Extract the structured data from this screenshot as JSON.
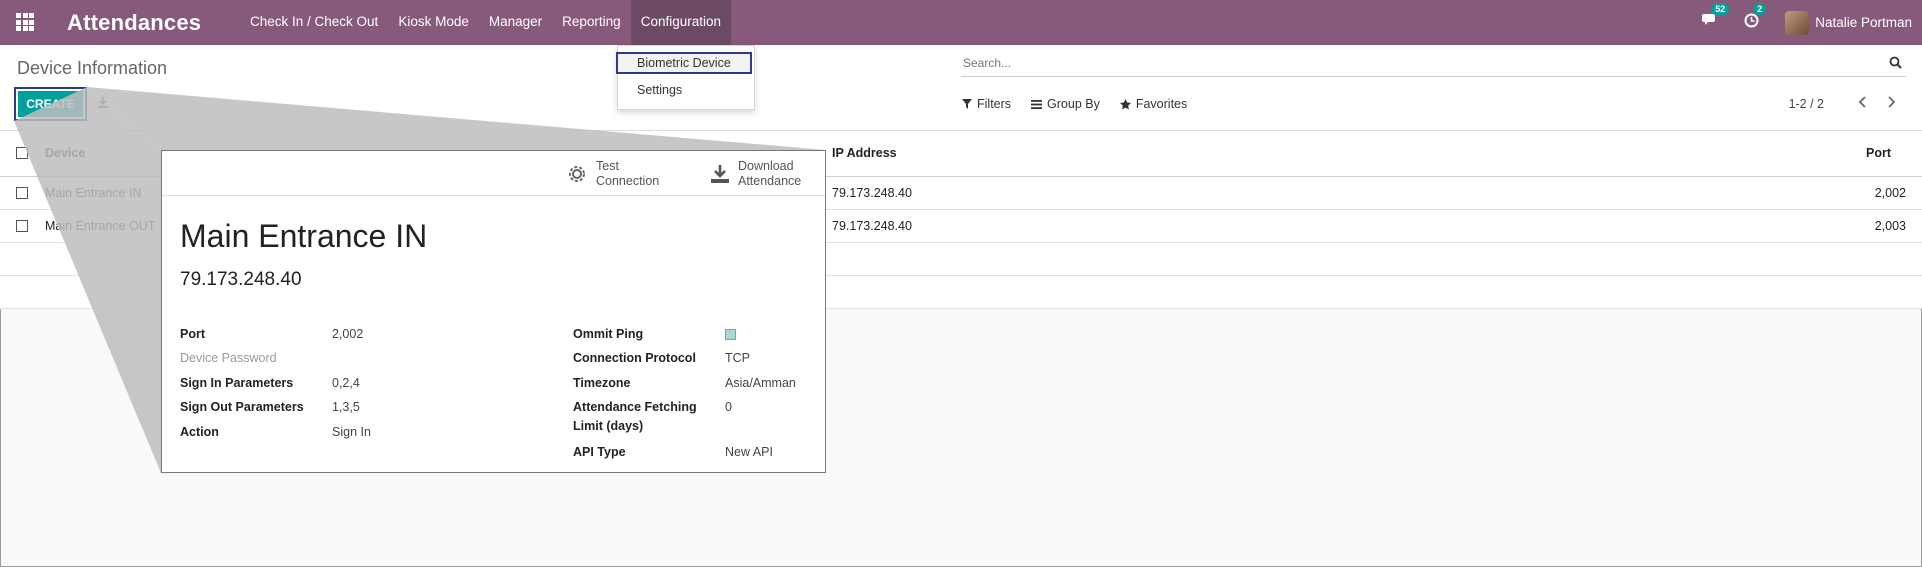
{
  "navbar": {
    "title": "Attendances",
    "menu": [
      "Check In / Check Out",
      "Kiosk Mode",
      "Manager",
      "Reporting",
      "Configuration"
    ],
    "messages_count": "52",
    "activities_count": "2",
    "user_name": "Natalie Portman",
    "color": "#875a7b"
  },
  "dropdown": {
    "items": [
      "Biometric Device",
      "Settings"
    ]
  },
  "control_panel": {
    "title": "Device Information",
    "create_label": "CREATE",
    "search_placeholder": "Search...",
    "filters_label": "Filters",
    "groupby_label": "Group By",
    "favorites_label": "Favorites",
    "pager": "1-2 / 2",
    "accent": "#00a09d"
  },
  "list": {
    "columns": [
      "Device",
      "IP Address",
      "Port"
    ],
    "rows": [
      {
        "device": "Main Entrance IN",
        "ip": "79.173.248.40",
        "port": "2,002"
      },
      {
        "device": "Main Entrance OUT",
        "ip": "79.173.248.40",
        "port": "2,003"
      }
    ]
  },
  "card": {
    "test_connection": [
      "Test",
      "Connection"
    ],
    "download_attendance": [
      "Download",
      "Attendance"
    ],
    "name": "Main Entrance IN",
    "ip": "79.173.248.40",
    "left_fields": [
      {
        "label": "Port",
        "value": "2,002"
      },
      {
        "label": "Device Password",
        "value": ""
      },
      {
        "label": "Sign In Parameters",
        "value": "0,2,4"
      },
      {
        "label": "Sign Out Parameters",
        "value": "1,3,5"
      },
      {
        "label": "Action",
        "value": "Sign In"
      }
    ],
    "right_fields": {
      "ommit_ping_label": "Ommit Ping",
      "ommit_ping_checked": true,
      "protocol_label": "Connection Protocol",
      "protocol_value": "TCP",
      "timezone_label": "Timezone",
      "timezone_value": "Asia/Amman",
      "fetch_label_1": "Attendance Fetching",
      "fetch_label_2": "Limit (days)",
      "fetch_value": "0",
      "api_label": "API Type",
      "api_value": "New API"
    }
  }
}
